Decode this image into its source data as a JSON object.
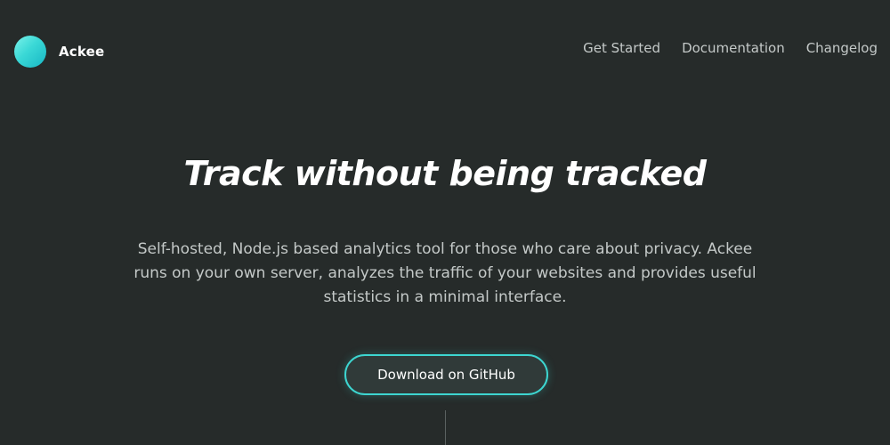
{
  "header": {
    "logo_text": "Ackee",
    "nav": [
      {
        "label": "Get Started"
      },
      {
        "label": "Documentation"
      },
      {
        "label": "Changelog"
      }
    ]
  },
  "hero": {
    "title": "Track without being tracked",
    "description": "Self-hosted, Node.js based analytics tool for those who care about privacy. Ackee runs on your own server, analyzes the traffic of your websites and provides useful statistics in a minimal interface.",
    "cta_label": "Download on GitHub"
  },
  "colors": {
    "background": "#262b2a",
    "accent": "#3dd6d1",
    "text_muted": "#c4c9c8"
  },
  "icons": {
    "logo": "ackee-logo-circle-icon"
  }
}
